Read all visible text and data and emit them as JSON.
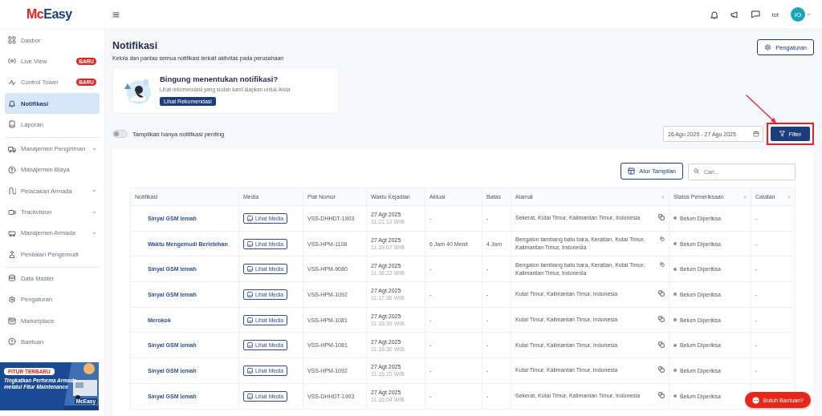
{
  "topbar": {
    "logo": [
      "Mc",
      "Easy"
    ],
    "user": "iot",
    "avatar": "IO"
  },
  "sidebar": {
    "groups": [
      [
        {
          "label": "Dasbor",
          "selected": false,
          "expandable": false
        },
        {
          "label": "Live View",
          "badge": "BARU",
          "selected": false,
          "expandable": false
        },
        {
          "label": "Control Tower",
          "badge": "BARU",
          "selected": false,
          "expandable": false
        },
        {
          "label": "Notifikasi",
          "selected": true,
          "expandable": false
        },
        {
          "label": "Laporan",
          "selected": false,
          "expandable": false
        }
      ],
      [
        {
          "label": "Manajemen Pengiriman",
          "selected": false,
          "expandable": true
        },
        {
          "label": "Manajemen Biaya",
          "selected": false,
          "expandable": false
        },
        {
          "label": "Pelacakan Armada",
          "selected": false,
          "expandable": true
        },
        {
          "label": "Trackvision",
          "selected": false,
          "expandable": true
        },
        {
          "label": "Manajemen Armada",
          "selected": false,
          "expandable": true
        },
        {
          "label": "Penilaian Pengemudi",
          "selected": false,
          "expandable": false
        }
      ],
      [
        {
          "label": "Data Master",
          "selected": false,
          "expandable": false
        },
        {
          "label": "Pengaturan",
          "selected": false,
          "expandable": false
        },
        {
          "label": "Marketplace",
          "selected": false,
          "expandable": false
        },
        {
          "label": "Bantuan",
          "selected": false,
          "expandable": false
        }
      ]
    ],
    "promo": {
      "tag": "FITUR TERBARU",
      "text": "Tingkatkan Performa Armada melalui Fitur Maintenance",
      "brand": "McEasy"
    }
  },
  "page": {
    "title": "Notifikasi",
    "subtitle": "Kelola dan pantau semua notifikasi terkait aktivitas pada perusahaan",
    "settings_button": "Pengaturan"
  },
  "recommendation": {
    "title": "Bingung menentukan notifikasi?",
    "text": "Lihat rekomendasi yang sudah kami siapkan untuk Anda",
    "button": "Lihat Rekomendasi"
  },
  "toggle": {
    "label": "Tampilkan hanya notifikasi penting",
    "on": false
  },
  "date_range": "26 Agu 2025 - 27 Agu 2025",
  "filter_button": {
    "label": "Filter",
    "highlighted": true
  },
  "table_toolbar": {
    "view_button": "Atur Tampilan",
    "search": {
      "placeholder": "Cari..."
    }
  },
  "table": {
    "columns": [
      {
        "label": "Notifikasi",
        "sortable": false
      },
      {
        "label": "Media",
        "sortable": false
      },
      {
        "label": "Plat Nomor",
        "sortable": false
      },
      {
        "label": "Waktu Kejadian",
        "sortable": false
      },
      {
        "label": "Aktual",
        "sortable": false
      },
      {
        "label": "Batas",
        "sortable": false
      },
      {
        "label": "Alamat",
        "sortable": true
      },
      {
        "label": "Status Pemeriksaan",
        "sortable": true
      },
      {
        "label": "Catatan",
        "sortable": true
      }
    ],
    "rows": [
      {
        "notification": "Sinyal GSM lemah",
        "media": "Lihat Media",
        "plate": "VSS-DHHDT-1903",
        "date": "27 Agt 2025",
        "time": "11:21:12 WIB",
        "actual": "-",
        "limit": "-",
        "address": "Sekerat, Kutai Timur, Kalimantan Timur, Indonesia",
        "status": "Belum Diperiksa",
        "note": "-"
      },
      {
        "notification": "Waktu Mengemudi Berlebihan",
        "media": "Lihat Media",
        "plate": "VSS-HPM-1106",
        "date": "27 Agt 2025",
        "time": "11:19:07 WIB",
        "actual": "6 Jam 40 Menit",
        "limit": "4 Jam",
        "address": "Bengalon tambang batu bara, Keraitan, Kutai Timur, Kalimantan Timur, Indonesia",
        "status": "Belum Diperiksa",
        "note": "-"
      },
      {
        "notification": "Sinyal GSM lemah",
        "media": "Lihat Media",
        "plate": "VSS-HPM-9080",
        "date": "27 Agt 2025",
        "time": "11:18:22 WIB",
        "actual": "-",
        "limit": "-",
        "address": "Bengalon tambang batu bara, Keraitan, Kutai Timur, Kalimantan Timur, Indonesia",
        "status": "Belum Diperiksa",
        "note": "-"
      },
      {
        "notification": "Sinyal GSM lemah",
        "media": "Lihat Media",
        "plate": "VSS-HPM-1092",
        "date": "27 Agt 2025",
        "time": "11:17:36 WIB",
        "actual": "-",
        "limit": "-",
        "address": "Kutai Timur, Kalimantan Timur, Indonesia",
        "status": "Belum Diperiksa",
        "note": "-"
      },
      {
        "notification": "Merokok",
        "media": "Lihat Media",
        "plate": "VSS-HPM-1081",
        "date": "27 Agt 2025",
        "time": "11:16:39 WIB",
        "actual": "-",
        "limit": "-",
        "address": "Kutai Timur, Kalimantan Timur, Indonesia",
        "status": "Belum Diperiksa",
        "note": "-"
      },
      {
        "notification": "Sinyal GSM lemah",
        "media": "Lihat Media",
        "plate": "VSS-HPM-1081",
        "date": "27 Agt 2025",
        "time": "11:16:30 WIB",
        "actual": "-",
        "limit": "-",
        "address": "Kutai Timur, Kalimantan Timur, Indonesia",
        "status": "Belum Diperiksa",
        "note": "-"
      },
      {
        "notification": "Sinyal GSM lemah",
        "media": "Lihat Media",
        "plate": "VSS-HPM-1092",
        "date": "27 Agt 2025",
        "time": "11:16:20 WIB",
        "actual": "-",
        "limit": "-",
        "address": "Kutai Timur, Kalimantan Timur, Indonesia",
        "status": "Belum Diperiksa",
        "note": "-"
      },
      {
        "notification": "Sinyal GSM lemah",
        "media": "Lihat Media",
        "plate": "VSS-DHHDT-1903",
        "date": "27 Agt 2025",
        "time": "11:16:04 WIB",
        "actual": "-",
        "limit": "-",
        "address": "Sekerat, Kutai Timur, Kalimantan Timur, Indonesia",
        "status": "Belum Diperiksa"
      }
    ]
  },
  "help_button": "Butuh Bantuan?"
}
